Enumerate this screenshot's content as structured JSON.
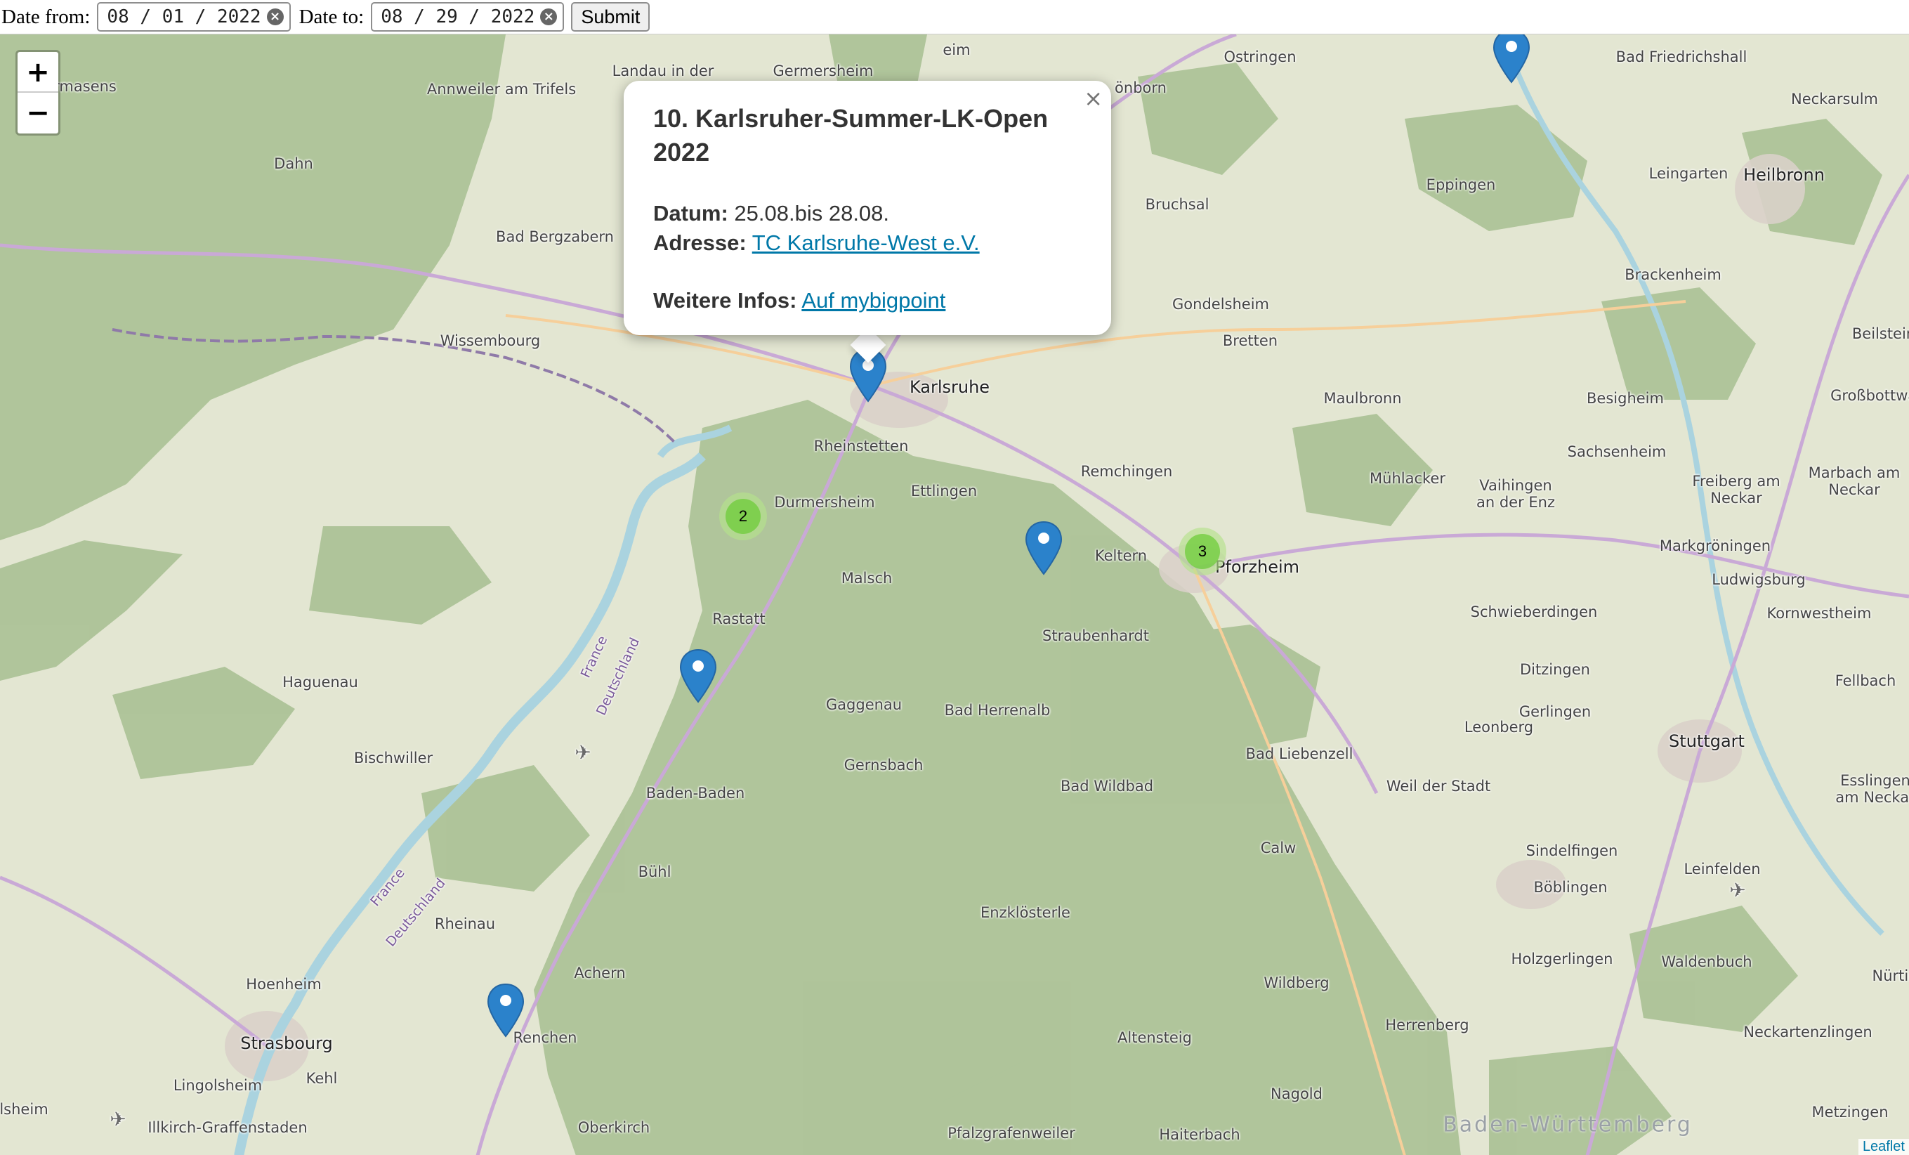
{
  "form": {
    "date_from_label": "Date from:",
    "date_from_value": "08 / 01 / 2022",
    "date_to_label": "Date to:",
    "date_to_value": "08 / 29 / 2022",
    "submit_label": "Submit"
  },
  "map": {
    "zoom_in": "+",
    "zoom_out": "−",
    "attribution": "Leaflet",
    "places": {
      "pirmasens": "Pirmasens",
      "annweiler": "Annweiler am Trifels",
      "landau": "Landau in der",
      "germersheim": "Germersheim",
      "eim": "eim",
      "schonborn": "önborn",
      "ostringen": "Ostringen",
      "bad_friedrichshall": "Bad Friedrichshall",
      "neckarsulm": "Neckarsulm",
      "dahn": "Dahn",
      "bruchsal": "Bruchsal",
      "eppingen": "Eppingen",
      "leingarten": "Leingarten",
      "heilbronn": "Heilbronn",
      "bad_bergzabern": "Bad Bergzabern",
      "brackenheim": "Brackenheim",
      "gondelsheim": "Gondelsheim",
      "wissembourg": "Wissembourg",
      "bretten": "Bretten",
      "beilstein": "Beilstein",
      "karlsruhe": "Karlsruhe",
      "maulbronn": "Maulbronn",
      "besigheim": "Besigheim",
      "grossbottwar": "Großbottwar",
      "rheinstetten": "Rheinstetten",
      "sachsenheim": "Sachsenheim",
      "remchingen": "Remchingen",
      "muhlacker": "Mühlacker",
      "vaihingen": "Vaihingen an der Enz",
      "freiberg": "Freiberg am Neckar",
      "marbach": "Marbach am Neckar",
      "durmersheim": "Durmersheim",
      "ettlingen": "Ettlingen",
      "markgroningen": "Markgröningen",
      "keltern": "Keltern",
      "pforzheim": "Pforzheim",
      "ludwigsburg": "Ludwigsburg",
      "malsch": "Malsch",
      "schwieberdingen": "Schwieberdingen",
      "kornwestheim": "Kornwestheim",
      "rastatt": "Rastatt",
      "straubenhardt": "Straubenhardt",
      "haguenau": "Haguenau",
      "ditzingen": "Ditzingen",
      "fellbach": "Fellbach",
      "gaggenau": "Gaggenau",
      "bad_herrenalb": "Bad Herrenalb",
      "gerlingen": "Gerlingen",
      "leonberg": "Leonberg",
      "stuttgart": "Stuttgart",
      "bischwiller": "Bischwiller",
      "gernsbach": "Gernsbach",
      "bad_liebenzell": "Bad Liebenzell",
      "baden_baden": "Baden-Baden",
      "bad_wildbad": "Bad Wildbad",
      "weil_der_stadt": "Weil der Stadt",
      "esslingen": "Esslingen am Neckar",
      "calw": "Calw",
      "buhl": "Bühl",
      "sindelfingen": "Sindelfingen",
      "leinfelden": "Leinfelden",
      "boblingen": "Böblingen",
      "enzklosterle": "Enzklösterle",
      "rheinau": "Rheinau",
      "holzgerlingen": "Holzgerlingen",
      "waldenbuch": "Waldenbuch",
      "hoenheim": "Hoenheim",
      "achern": "Achern",
      "wildberg": "Wildberg",
      "nurtingen": "Nürtin",
      "renchen": "Renchen",
      "strasbourg": "Strasbourg",
      "herrenberg": "Herrenberg",
      "neckartenzlingen": "Neckartenzlingen",
      "altensteig": "Altensteig",
      "kehl": "Kehl",
      "lingolsheim": "Lingolsheim",
      "nagold": "Nagold",
      "schiltigheim": "lsheim",
      "illkirch": "Illkirch-Graffenstaden",
      "oberkirch": "Oberkirch",
      "pfalzgrafenweiler": "Pfalzgrafenweiler",
      "haiterbach": "Haiterbach",
      "metzingen": "Metzingen",
      "baden_wurttemberg": "Baden-Württemberg",
      "france": "France",
      "deutschland": "Deutschland",
      "france2": "France",
      "deutschland2": "Deutschland"
    },
    "clusters": [
      {
        "count": "2"
      },
      {
        "count": "3"
      }
    ]
  },
  "popup": {
    "title": "10. Karlsruher-Summer-LK-Open 2022",
    "datum_label": "Datum:",
    "datum_value": "25.08.bis 28.08.",
    "adresse_label": "Adresse:",
    "adresse_link": "TC Karlsruhe-West e.V.",
    "infos_label": "Weitere Infos:",
    "infos_link": "Auf mybigpoint",
    "close": "×"
  }
}
